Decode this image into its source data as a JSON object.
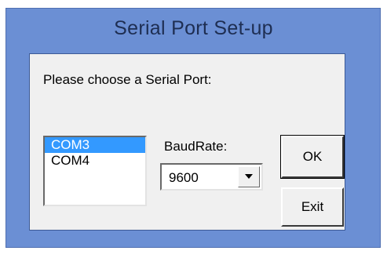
{
  "window": {
    "title": "Serial Port Set-up",
    "background_color": "#6b8fd4"
  },
  "dialog": {
    "prompt": "Please choose a Serial Port:",
    "ports": [
      {
        "label": "COM3",
        "selected": true
      },
      {
        "label": "COM4",
        "selected": false
      }
    ],
    "selection_color": "#3399ff",
    "baud_label": "BaudRate:",
    "baud_value": "9600",
    "dropdown_icon": "triangle-down-icon",
    "ok_label": "OK",
    "exit_label": "Exit"
  }
}
